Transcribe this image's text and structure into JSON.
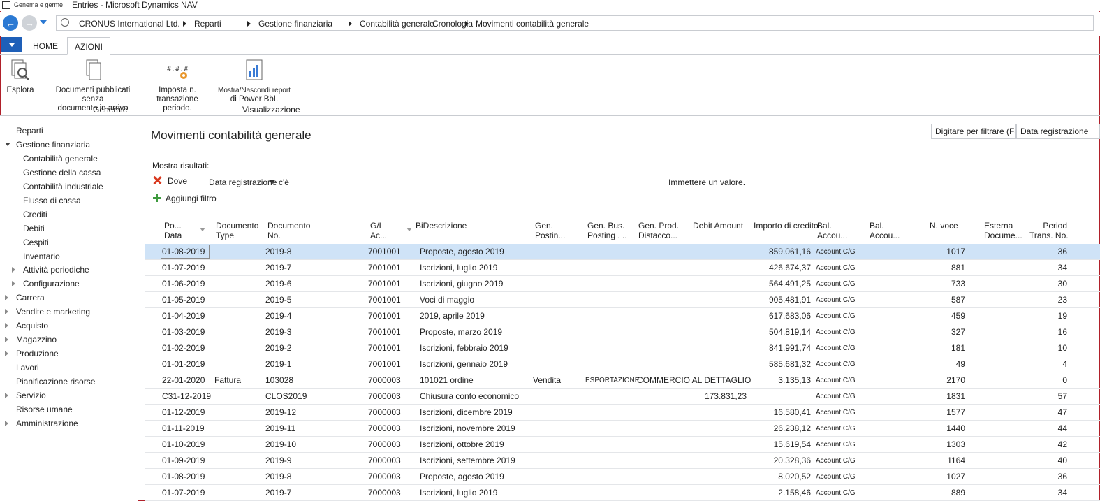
{
  "window": {
    "company_small": "Genema e germe",
    "title": "Entries - Microsoft Dynamics NAV"
  },
  "breadcrumb": [
    "CRONUS International Ltd.",
    "Reparti",
    "Gestione finanziaria",
    "Contabilità generale",
    "Cronologia",
    "Movimenti contabilità generale"
  ],
  "ribbon": {
    "tabs": [
      "HOME",
      "AZIONI"
    ],
    "active_tab": "AZIONI",
    "buttons": {
      "esplora": "Esplora",
      "documenti_line1": "Documenti pubblicati senza",
      "documenti_line2": "documento in arrivo",
      "imposta_line1": "Imposta n.",
      "imposta_line2": "transazione periodo.",
      "powerbi_line1": "Mostra/Nascondi report",
      "powerbi_line2": "di Power BbI."
    },
    "groups": {
      "generale": "Generale",
      "visualizzazione": "Visualizzazione"
    }
  },
  "sidebar": {
    "items": [
      "Reparti",
      "Gestione finanziaria",
      "Contabilità generale",
      "Gestione della cassa",
      "Contabilità industriale",
      "Flusso di cassa",
      "Crediti",
      "Debiti",
      "Cespiti",
      "Inventario",
      "Attività periodiche",
      "Configurazione",
      "Carrera",
      "Vendite e marketing",
      "Acquisto",
      "Magazzino",
      "Produzione",
      "Lavori",
      "Pianificazione risorse",
      "Servizio",
      "Risorse umane",
      "Amministrazione"
    ]
  },
  "page": {
    "title": "Movimenti contabilità generale",
    "filter_placeholder": "Digitare per filtrare (F3)",
    "filter_field": "Data registrazione",
    "show_results": "Mostra risultati:",
    "where": "Dove",
    "filter_column": "Data registrazione",
    "is_label": "c'è",
    "enter_value": "Immettere un valore.",
    "add_filter": "Aggiungi filtro"
  },
  "table": {
    "headers": {
      "posting_date_1": "Po...",
      "posting_date_2": "Data",
      "doc_type_1": "Documento",
      "doc_type_2": "Type",
      "doc_no_1": "Documento",
      "doc_no_2": "No.",
      "gl_1": "G/L",
      "gl_2": "Ac...",
      "description": "BiDescrizione",
      "gen_post_1": "Gen.",
      "gen_post_2": "Postin...",
      "gen_bus_1": "Gen. Bus.",
      "gen_bus_2": "Posting . ..",
      "gen_prod_1": "Gen. Prod.",
      "gen_prod_2": "Distacco...",
      "debit": "Debit Amount",
      "credit": "Importo di credito",
      "bal1_1": "Bal.",
      "bal1_2": "Accou...",
      "bal2_1": "Bal.",
      "bal2_2": "Accou...",
      "entry_no": "N. voce",
      "ext_1": "Esterna",
      "ext_2": "Docume...",
      "period_1": "Period",
      "period_2": "Trans. No."
    },
    "rows": [
      {
        "date": "01-08-2019",
        "type": "",
        "doc": "2019-8",
        "gl": "7001001",
        "desc": "Proposte, agosto 2019",
        "gen": "",
        "bus": "",
        "prod": "",
        "debit": "",
        "credit": "859.061,16",
        "bal": "Account C/G",
        "entry": "1017",
        "period": "36"
      },
      {
        "date": "01-07-2019",
        "type": "",
        "doc": "2019-7",
        "gl": "7001001",
        "desc": "Iscrizioni, luglio 2019",
        "gen": "",
        "bus": "",
        "prod": "",
        "debit": "",
        "credit": "426.674,37",
        "bal": "Account C/G",
        "entry": "881",
        "period": "34"
      },
      {
        "date": "01-06-2019",
        "type": "",
        "doc": "2019-6",
        "gl": "7001001",
        "desc": "Iscrizioni, giugno 2019",
        "gen": "",
        "bus": "",
        "prod": "",
        "debit": "",
        "credit": "564.491,25",
        "bal": "Account C/G",
        "entry": "733",
        "period": "30"
      },
      {
        "date": "01-05-2019",
        "type": "",
        "doc": "2019-5",
        "gl": "7001001",
        "desc": "Voci di maggio",
        "gen": "",
        "bus": "",
        "prod": "",
        "debit": "",
        "credit": "905.481,91",
        "bal": "Account C/G",
        "entry": "587",
        "period": "23"
      },
      {
        "date": "01-04-2019",
        "type": "",
        "doc": "2019-4",
        "gl": "7001001",
        "desc": "2019, aprile 2019",
        "gen": "",
        "bus": "",
        "prod": "",
        "debit": "",
        "credit": "617.683,06",
        "bal": "Account C/G",
        "entry": "459",
        "period": "19"
      },
      {
        "date": "01-03-2019",
        "type": "",
        "doc": "2019-3",
        "gl": "7001001",
        "desc": "Proposte, marzo 2019",
        "gen": "",
        "bus": "",
        "prod": "",
        "debit": "",
        "credit": "504.819,14",
        "bal": "Account C/G",
        "entry": "327",
        "period": "16"
      },
      {
        "date": "01-02-2019",
        "type": "",
        "doc": "2019-2",
        "gl": "7001001",
        "desc": "Iscrizioni, febbraio 2019",
        "gen": "",
        "bus": "",
        "prod": "",
        "debit": "",
        "credit": "841.991,74",
        "bal": "Account C/G",
        "entry": "181",
        "period": "10"
      },
      {
        "date": "01-01-2019",
        "type": "",
        "doc": "2019-1",
        "gl": "7001001",
        "desc": "Iscrizioni, gennaio 2019",
        "gen": "",
        "bus": "",
        "prod": "",
        "debit": "",
        "credit": "585.681,32",
        "bal": "Account C/G",
        "entry": "49",
        "period": "4"
      },
      {
        "date": "22-01-2020",
        "type": "Fattura",
        "doc": "103028",
        "gl": "7000003",
        "desc": "101021 ordine",
        "gen": "Vendita",
        "bus": "ESPORTAZIONE",
        "prod": "COMMERCIO AL DETTAGLIO",
        "debit": "",
        "credit": "3.135,13",
        "bal": "Account C/G",
        "entry": "2170",
        "period": "0"
      },
      {
        "date": "C31-12-2019",
        "type": "",
        "doc": "CLOS2019",
        "gl": "7000003",
        "desc": "Chiusura conto economico",
        "gen": "",
        "bus": "",
        "prod": "",
        "debit": "173.831,23",
        "credit": "",
        "bal": "Account C/G",
        "entry": "1831",
        "period": "57"
      },
      {
        "date": "01-12-2019",
        "type": "",
        "doc": "2019-12",
        "gl": "7000003",
        "desc": "Iscrizioni, dicembre 2019",
        "gen": "",
        "bus": "",
        "prod": "",
        "debit": "",
        "credit": "16.580,41",
        "bal": "Account C/G",
        "entry": "1577",
        "period": "47"
      },
      {
        "date": "01-11-2019",
        "type": "",
        "doc": "2019-11",
        "gl": "7000003",
        "desc": "Iscrizioni, novembre 2019",
        "gen": "",
        "bus": "",
        "prod": "",
        "debit": "",
        "credit": "26.238,12",
        "bal": "Account C/G",
        "entry": "1440",
        "period": "44"
      },
      {
        "date": "01-10-2019",
        "type": "",
        "doc": "2019-10",
        "gl": "7000003",
        "desc": "Iscrizioni, ottobre 2019",
        "gen": "",
        "bus": "",
        "prod": "",
        "debit": "",
        "credit": "15.619,54",
        "bal": "Account C/G",
        "entry": "1303",
        "period": "42"
      },
      {
        "date": "01-09-2019",
        "type": "",
        "doc": "2019-9",
        "gl": "7000003",
        "desc": "Iscrizioni, settembre 2019",
        "gen": "",
        "bus": "",
        "prod": "",
        "debit": "",
        "credit": "20.328,36",
        "bal": "Account C/G",
        "entry": "1164",
        "period": "40"
      },
      {
        "date": "01-08-2019",
        "type": "",
        "doc": "2019-8",
        "gl": "7000003",
        "desc": "Proposte, agosto 2019",
        "gen": "",
        "bus": "",
        "prod": "",
        "debit": "",
        "credit": "8.020,52",
        "bal": "Account C/G",
        "entry": "1027",
        "period": "36"
      },
      {
        "date": "01-07-2019",
        "type": "",
        "doc": "2019-7",
        "gl": "7000003",
        "desc": "Iscrizioni, luglio 2019",
        "gen": "",
        "bus": "",
        "prod": "",
        "debit": "",
        "credit": "2.158,46",
        "bal": "Account C/G",
        "entry": "889",
        "period": "34"
      }
    ]
  },
  "colors": {
    "accent": "#1e5fb8",
    "selected_row": "#cfe3f7",
    "remove_filter": "#d9381e",
    "add_filter": "#3e9a3e"
  }
}
